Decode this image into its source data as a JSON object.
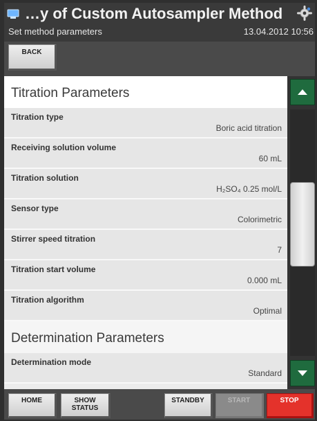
{
  "header": {
    "title": "…y of Custom Autosampler Method",
    "subtitle": "Set method parameters",
    "datetime": "13.04.2012 10:56",
    "app_icon": "monitor-icon",
    "settings_icon": "gear-icon"
  },
  "toolbar": {
    "back_label": "BACK"
  },
  "sections": {
    "titration": "Titration Parameters",
    "determination": "Determination Parameters"
  },
  "rows": [
    {
      "label": "Titration type",
      "value": "Boric acid titration"
    },
    {
      "label": "Receiving solution volume",
      "value": "60 mL"
    },
    {
      "label": "Titration solution",
      "value": "H₂SO₄ 0.25 mol/L"
    },
    {
      "label": "Sensor type",
      "value": "Colorimetric"
    },
    {
      "label": "Stirrer speed titration",
      "value": "7"
    },
    {
      "label": "Titration start volume",
      "value": "0.000 mL"
    },
    {
      "label": "Titration algorithm",
      "value": "Optimal"
    },
    {
      "label": "Determination mode",
      "value": "Standard"
    }
  ],
  "bottom": {
    "home": "HOME",
    "show_status": "SHOW STATUS",
    "standby": "STANDBY",
    "start": "START",
    "stop": "STOP"
  },
  "colors": {
    "accent_green": "#1f6b3e",
    "stop_red": "#e4322b"
  }
}
